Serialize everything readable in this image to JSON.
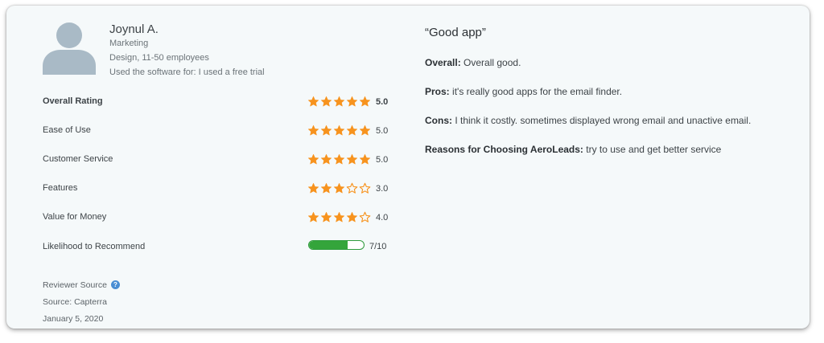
{
  "reviewer": {
    "name": "Joynul A.",
    "role": "Marketing",
    "company": "Design, 11-50 employees",
    "usage": "Used the software for: I used a free trial"
  },
  "ratings": [
    {
      "label": "Overall Rating",
      "value": "5.0",
      "stars": 5
    },
    {
      "label": "Ease of Use",
      "value": "5.0",
      "stars": 5
    },
    {
      "label": "Customer Service",
      "value": "5.0",
      "stars": 5
    },
    {
      "label": "Features",
      "value": "3.0",
      "stars": 3
    },
    {
      "label": "Value for Money",
      "value": "4.0",
      "stars": 4
    }
  ],
  "recommend": {
    "label": "Likelihood to Recommend",
    "value": "7/10",
    "fraction": 0.7
  },
  "source": {
    "heading": "Reviewer Source",
    "help_icon": "?",
    "site": "Source: Capterra",
    "date": "January 5, 2020"
  },
  "review": {
    "title": "“Good app”",
    "overall_label": "Overall:",
    "overall_text": " Overall good.",
    "pros_label": "Pros:",
    "pros_text": " it's really good apps for the email finder.",
    "cons_label": "Cons:",
    "cons_text": " I think it costly. sometimes displayed wrong email and unactive email.",
    "reasons_label": "Reasons for Choosing AeroLeads:",
    "reasons_text": " try to use and get better service"
  },
  "colors": {
    "star": "#f7931e",
    "meter": "#34a53b",
    "avatar": "#a9bac6"
  }
}
